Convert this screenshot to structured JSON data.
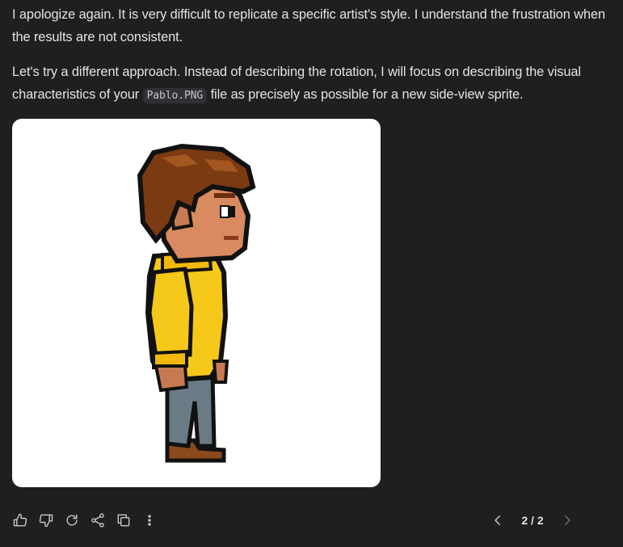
{
  "response": {
    "paragraph1": "I apologize again. It is very difficult to replicate a specific artist's style. I understand the frustration when the results are not consistent.",
    "paragraph2_before": "Let's try a different approach. Instead of describing the rotation, I will focus on describing the visual characteristics of your ",
    "paragraph2_code": "Pablo.PNG",
    "paragraph2_after": " file as precisely as possible for a new side-view sprite."
  },
  "actions": {
    "icons": [
      "thumbs-up-icon",
      "thumbs-down-icon",
      "regenerate-icon",
      "share-icon",
      "copy-icon",
      "more-vert-icon"
    ]
  },
  "pager": {
    "label": "2 / 2"
  },
  "colors": {
    "background": "#1e1f20",
    "text": "#e3e3e3",
    "icon": "#c4c7c5",
    "sweater": "#f6c81a",
    "hair": "#7a3a12",
    "skin": "#d98a60",
    "pants": "#6b7b85"
  }
}
